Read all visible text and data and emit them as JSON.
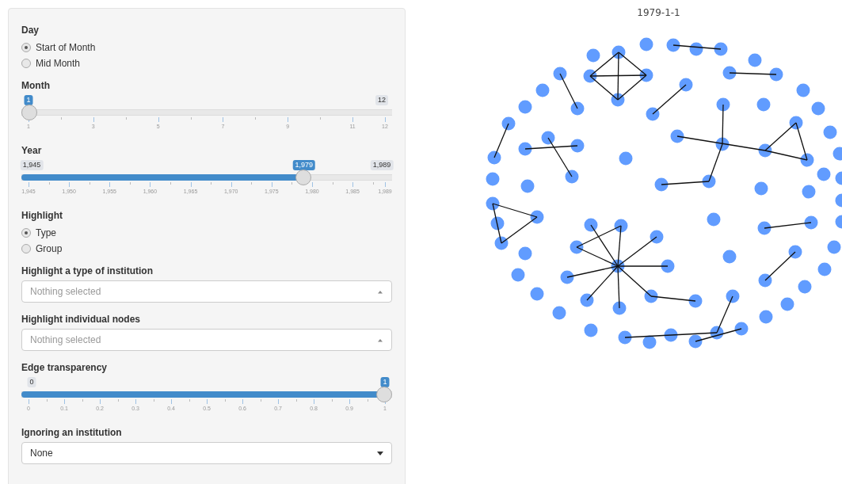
{
  "panel": {
    "sections": [
      {
        "kind": "radio",
        "label": "Day",
        "options": [
          {
            "label": "Start of Month",
            "selected": true
          },
          {
            "label": "Mid Month",
            "selected": false
          }
        ]
      },
      {
        "kind": "slider",
        "label": "Month",
        "level": 0,
        "value_label": "1",
        "max_label": "12",
        "ticks": [
          "1",
          "3",
          "5",
          "7",
          "9",
          "11",
          "12"
        ]
      },
      {
        "kind": "slider",
        "label": "Year",
        "level": 0.7727,
        "min_label": "1,945",
        "value_label": "1,979",
        "max_label": "1,989",
        "ticks": [
          "1,945",
          "1,950",
          "1,955",
          "1,960",
          "1,965",
          "1,970",
          "1,975",
          "1,980",
          "1,985",
          "1,989"
        ]
      },
      {
        "kind": "radio",
        "label": "Highlight",
        "options": [
          {
            "label": "Type",
            "selected": true
          },
          {
            "label": "Group",
            "selected": false
          }
        ]
      },
      {
        "kind": "select",
        "label": "Highlight a type of institution",
        "placeholder": "Nothing selected"
      },
      {
        "kind": "select",
        "label": "Highlight individual nodes",
        "placeholder": "Nothing selected"
      },
      {
        "kind": "slider",
        "label": "Edge transparency",
        "level": 1,
        "min_label": "0",
        "value_label": "1",
        "ticks": [
          "0",
          "0.1",
          "0.2",
          "0.3",
          "0.4",
          "0.5",
          "0.6",
          "0.7",
          "0.8",
          "0.9",
          "1"
        ]
      },
      {
        "kind": "dropdown",
        "label": "Ignoring an institution",
        "value": "None"
      }
    ]
  },
  "plot": {
    "title": "1979-1-1"
  }
}
